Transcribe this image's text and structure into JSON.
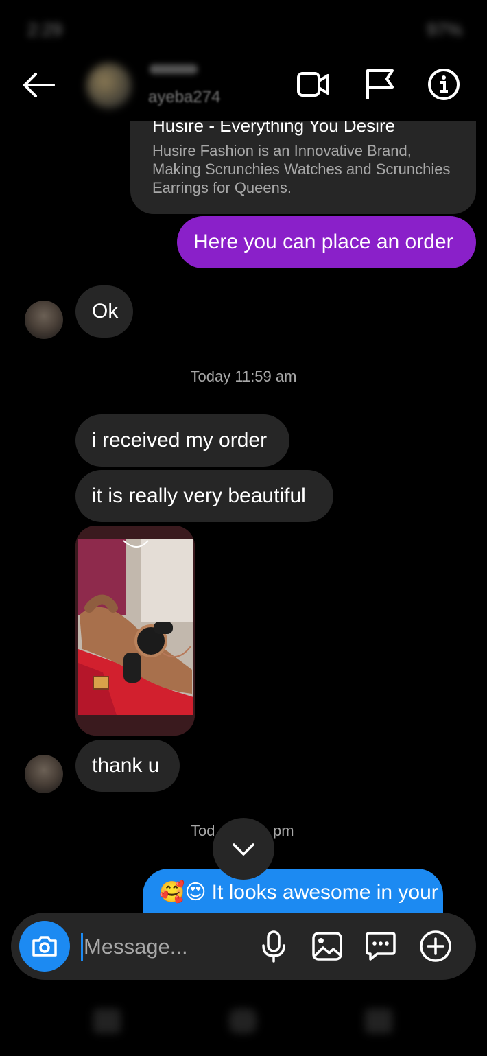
{
  "status_bar": {
    "time": "2:29",
    "battery": "97%"
  },
  "header": {
    "username": "ayeba274"
  },
  "link_preview": {
    "title": "Husire - Everything You Desire",
    "description": "Husire Fashion is an Innovative Brand, Making Scrunchies Watches and Scrunchies Earrings for Queens."
  },
  "messages": {
    "m1": "Here you can place an order",
    "m2": "Ok",
    "ts1": "Today 11:59 am",
    "m3": "i received my order",
    "m4": "it is really very beautiful",
    "m5": "thank u",
    "ts2_left": "Tod",
    "ts2_right": "pm",
    "m6_emoji": "🥰😍",
    "m6_text": "It looks awesome in your"
  },
  "composer": {
    "placeholder": "Message..."
  },
  "colors": {
    "background": "#000000",
    "incoming_bubble": "#262626",
    "outgoing_purple": "#8a20c9",
    "outgoing_blue": "#1c8af2",
    "camera_button": "#1c8af2"
  }
}
